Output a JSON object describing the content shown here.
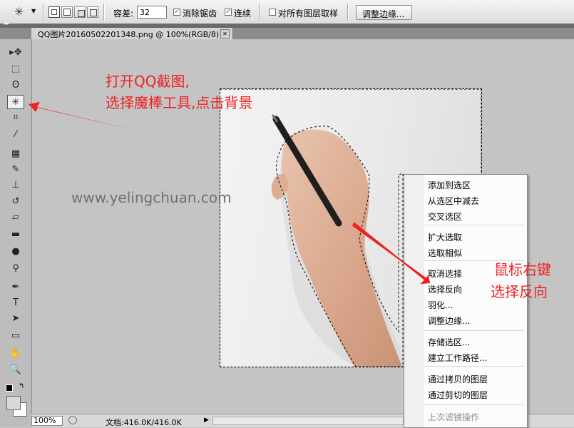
{
  "options_bar": {
    "tolerance_label": "容差:",
    "tolerance_value": "32",
    "antialias_label": "消除锯齿",
    "contiguous_label": "连续",
    "sample_all_label": "对所有图层取样",
    "refine_edge_button": "调整边缘..."
  },
  "document_tab": {
    "title": "QQ图片20160502201348.png @ 100%(RGB/8)",
    "close_glyph": "✕"
  },
  "toolbox": {
    "expand_glyph": "▸▸",
    "tools": [
      {
        "name": "move",
        "glyph": "▸✥"
      },
      {
        "name": "marquee",
        "glyph": "⬚"
      },
      {
        "name": "lasso",
        "glyph": "ʘ"
      },
      {
        "name": "magic-wand",
        "glyph": "✳"
      },
      {
        "name": "crop",
        "glyph": "⌗"
      },
      {
        "name": "eyedropper",
        "glyph": "⁄"
      },
      {
        "name": "healing",
        "glyph": "▦"
      },
      {
        "name": "brush",
        "glyph": "✎"
      },
      {
        "name": "clone-stamp",
        "glyph": "⊥"
      },
      {
        "name": "history-brush",
        "glyph": "↺"
      },
      {
        "name": "eraser",
        "glyph": "▱"
      },
      {
        "name": "gradient",
        "glyph": "▬"
      },
      {
        "name": "blur",
        "glyph": "●"
      },
      {
        "name": "dodge",
        "glyph": "⚲"
      },
      {
        "name": "pen",
        "glyph": "✒"
      },
      {
        "name": "type",
        "glyph": "T"
      },
      {
        "name": "path-selection",
        "glyph": "➤"
      },
      {
        "name": "shape",
        "glyph": "▭"
      },
      {
        "name": "hand",
        "glyph": "✋"
      },
      {
        "name": "zoom",
        "glyph": "🔍"
      }
    ]
  },
  "status_bar": {
    "zoom": "100%",
    "doc_info": "文档:416.0K/416.0K",
    "arrow_glyph": "▶"
  },
  "context_menu": {
    "items": [
      {
        "label": "添加到选区",
        "disabled": false
      },
      {
        "label": "从选区中减去",
        "disabled": false
      },
      {
        "label": "交叉选区",
        "disabled": false
      },
      {
        "label": "扩大选取",
        "disabled": false
      },
      {
        "label": "选取相似",
        "disabled": false
      },
      {
        "label": "取消选择",
        "disabled": false
      },
      {
        "label": "选择反向",
        "disabled": false
      },
      {
        "label": "羽化...",
        "disabled": false
      },
      {
        "label": "调整边缘...",
        "disabled": false
      },
      {
        "label": "存储选区...",
        "disabled": false
      },
      {
        "label": "建立工作路径...",
        "disabled": false
      },
      {
        "label": "通过拷贝的图层",
        "disabled": false
      },
      {
        "label": "通过剪切的图层",
        "disabled": false
      },
      {
        "label": "上次滤镜操作",
        "disabled": true
      }
    ]
  },
  "annotations": {
    "step1_line1": "打开QQ截图,",
    "step1_line2": "选择魔棒工具,点击背景",
    "watermark": "www.yelingchuan.com",
    "step2_line1": "鼠标右键",
    "step2_line2": "选择反向",
    "annotation_color": "#ee2222"
  }
}
